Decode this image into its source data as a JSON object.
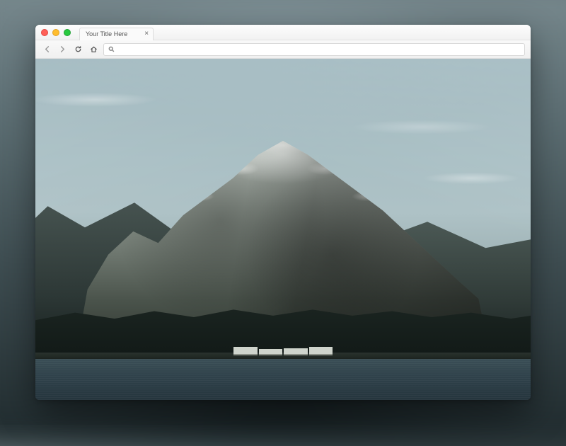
{
  "window": {
    "tab_title": "Your Title Here",
    "address_value": ""
  }
}
